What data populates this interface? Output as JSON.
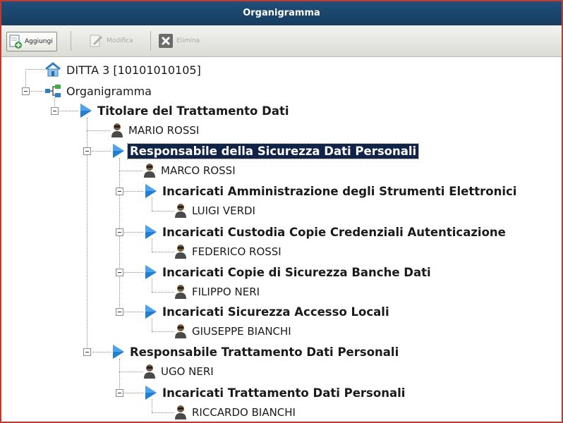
{
  "window": {
    "title": "Organigramma"
  },
  "toolbar": {
    "add_label": "Aggiungi",
    "edit_label": "Modifica",
    "delete_label": "Elimina"
  },
  "tree": {
    "company": "DITTA 3 [10101010105]",
    "root": "Organigramma",
    "nodes": [
      "Titolare del Trattamento Dati",
      "MARIO ROSSI",
      "Responsabile della Sicurezza Dati Personali",
      "MARCO ROSSI",
      "Incaricati Amministrazione degli Strumenti Elettronici",
      "LUIGI VERDI",
      "Incaricati Custodia Copie Credenziali Autenticazione",
      "FEDERICO ROSSI",
      "Incaricati Copie di Sicurezza Banche Dati",
      "FILIPPO NERI",
      "Incaricati Sicurezza Accesso Locali",
      "GIUSEPPE BIANCHI",
      "Responsabile Trattamento Dati Personali",
      "UGO NERI",
      "Incaricati Trattamento Dati Personali",
      "RICCARDO BIANCHI"
    ]
  },
  "colors": {
    "titlebar": "#1f4f7a",
    "border": "#c23a2e",
    "selection": "#10234a",
    "role_icon": "#1e7fd6"
  }
}
